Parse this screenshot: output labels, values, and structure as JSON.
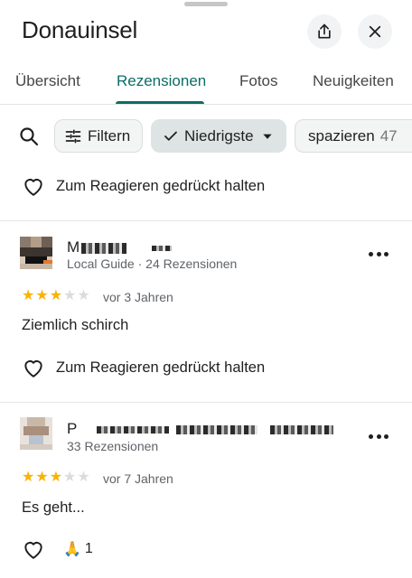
{
  "header": {
    "title": "Donauinsel"
  },
  "tabs": [
    {
      "label": "Übersicht",
      "active": false
    },
    {
      "label": "Rezensionen",
      "active": true
    },
    {
      "label": "Fotos",
      "active": false
    },
    {
      "label": "Neuigkeiten",
      "active": false
    }
  ],
  "filters": {
    "filter_label": "Filtern",
    "sort_label": "Niedrigste",
    "topic_label": "spazieren",
    "topic_count": "47"
  },
  "top_react": {
    "label": "Zum Reagieren gedrückt halten"
  },
  "reviews": [
    {
      "name": "M",
      "meta": "Local Guide · 24 Rezensionen",
      "rating": 3,
      "when": "vor 3 Jahren",
      "text": "Ziemlich schirch",
      "react_label": "Zum Reagieren gedrückt halten"
    },
    {
      "name": "P",
      "meta": "33 Rezensionen",
      "rating": 3,
      "when": "vor 7 Jahren",
      "text": "Es geht...",
      "reaction_emoji": "🙏",
      "reaction_count": "1"
    }
  ],
  "colors": {
    "accent": "#0b6d66",
    "star": "#f9b300",
    "star_off": "#dadce0",
    "sort_chip_bg": "#dde4e3"
  },
  "icons": [
    "share-icon",
    "close-icon",
    "search-icon",
    "filter-sliders-icon",
    "check-icon",
    "caret-down-icon",
    "heart-icon",
    "more-icon",
    "pray-icon"
  ]
}
